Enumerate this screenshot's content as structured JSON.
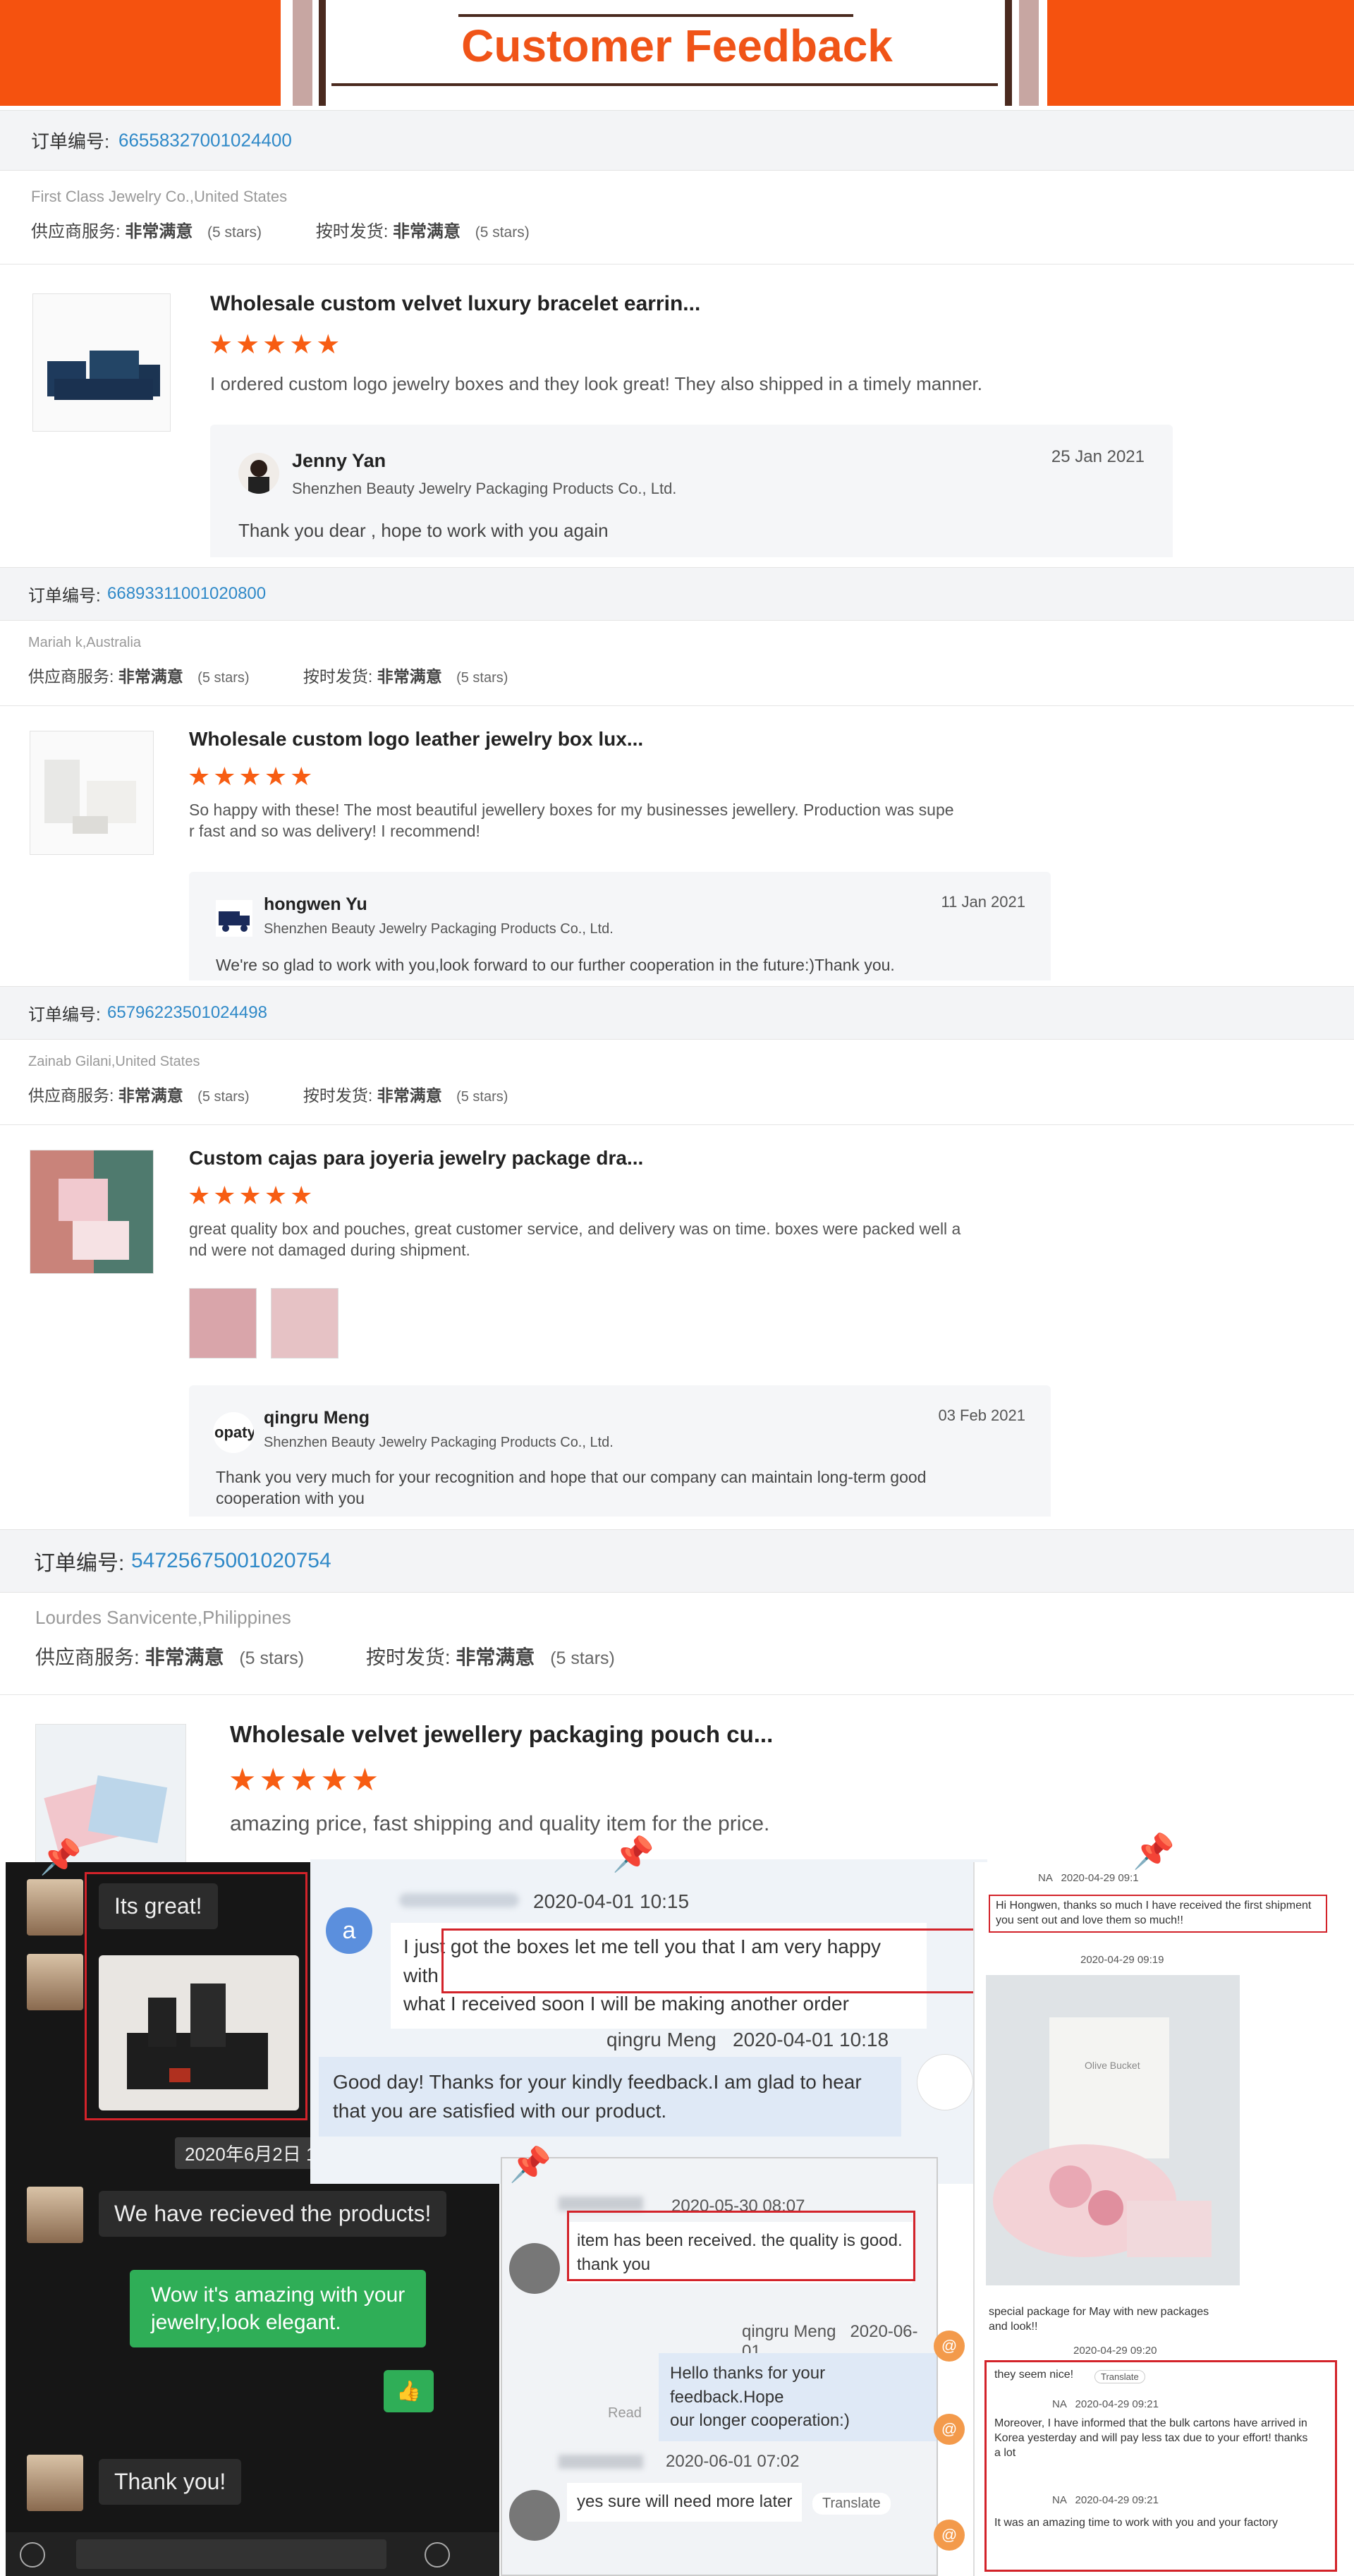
{
  "banner": {
    "title": "Customer Feedback"
  },
  "order_label": "订单编号:",
  "supplier_service_label": "供应商服务:",
  "on_time_label": "按时发货:",
  "very_satisfied": "非常满意",
  "five_stars": "(5 stars)",
  "stars": "★★★★★",
  "orders": [
    {
      "order_no": "66558327001024400",
      "buyer": "First Class Jewelry Co.,United States",
      "product": "Wholesale custom velvet luxury bracelet earrin...",
      "review": "I ordered custom logo jewelry boxes and they look great! They also shipped in a timely manner.",
      "reply_name": "Jenny Yan",
      "reply_company": "Shenzhen Beauty Jewelry Packaging Products Co., Ltd.",
      "reply_date": "25 Jan 2021",
      "reply_text": "Thank you dear , hope to work with you again"
    },
    {
      "order_no": "66893311001020800",
      "buyer": "Mariah k,Australia",
      "product": "Wholesale custom logo leather jewelry box lux...",
      "review_l1": "So happy with these! The most beautiful jewellery boxes for my businesses jewellery. Production was supe",
      "review_l2": "r fast and so was delivery! I recommend!",
      "reply_name": "hongwen Yu",
      "reply_company": "Shenzhen Beauty Jewelry Packaging Products Co., Ltd.",
      "reply_date": "11 Jan 2021",
      "reply_text": "We're so glad to work with you,look forward to our further cooperation in the future:)Thank you."
    },
    {
      "order_no": "65796223501024498",
      "buyer": "Zainab Gilani,United States",
      "product": "Custom cajas para joyeria jewelry package dra...",
      "review_l1": "great quality box and pouches, great customer service, and delivery was on time. boxes were packed well a",
      "review_l2": "nd were not damaged during shipment.",
      "reply_name": "qingru Meng",
      "reply_company": "Shenzhen Beauty Jewelry Packaging Products Co., Ltd.",
      "reply_date": "03 Feb 2021",
      "reply_text_l1": "Thank you very much for your recognition and hope that our company can maintain long-term good",
      "reply_text_l2": "cooperation with you"
    },
    {
      "order_no": "54725675001020754",
      "buyer": "Lourdes Sanvicente,Philippines",
      "product": "Wholesale velvet jewellery packaging pouch cu...",
      "review": "amazing price, fast shipping and quality item for the price."
    }
  ],
  "chat_left": {
    "msg1": "Its great!",
    "date": "2020年6月2日 1",
    "msg2": "We have recieved the products!",
    "reply1_l1": "Wow it's amazing with your",
    "reply1_l2": "jewelry,look elegant.",
    "thumb": "👍",
    "msg3": "Thank you!"
  },
  "chat_mid": {
    "avatar_letter": "a",
    "sender_time": "2020-04-01 10:15",
    "msg_l1": "I just got the boxes let me tell you that I am very happy with",
    "msg_l2": "what I received soon I will be making another order",
    "reply_sender": "qingru Meng",
    "reply_time": "2020-04-01 10:18",
    "reply_l1": "Good day! Thanks for your kindly feedback.I am glad to hear",
    "reply_l2": "that you are satisfied with our product."
  },
  "chat_right": {
    "na1": "NA",
    "t1": "2020-04-29 09:1",
    "msg1_l1": "Hi Hongwen, thanks so much I have received the first shipment",
    "msg1_l2": "you sent out and love them so much!!",
    "t2": "2020-04-29 09:19",
    "photo_text": "Olive Bucket",
    "msg2_l1": "special package for May with new packages",
    "msg2_l2": "and look!!",
    "t3": "2020-04-29 09:20",
    "msg3": "they seem nice!",
    "translate": "Translate",
    "na2": "NA",
    "t4": "2020-04-29 09:21",
    "msg4_l1": "Moreover, I have informed that the bulk cartons have arrived in",
    "msg4_l2": "Korea yesterday and will pay less tax due to your effort! thanks",
    "msg4_l3": "a lot",
    "na3": "NA",
    "t5": "2020-04-29 09:21",
    "msg5": "It was an amazing time to work with you and your factory"
  },
  "chat_bottom": {
    "t1": "2020-05-30 08:07",
    "msg1": "item has been received. the quality is good.",
    "msg1b": "thank you",
    "reply_sender": "qingru Meng",
    "reply_time": "2020-06-01",
    "reply_l1": "Hello thanks for your feedback.Hope",
    "reply_l2": "our longer cooperation:)",
    "read": "Read",
    "t2": "2020-06-01 07:02",
    "msg2": "yes sure will need more later",
    "translate": "Translate"
  }
}
